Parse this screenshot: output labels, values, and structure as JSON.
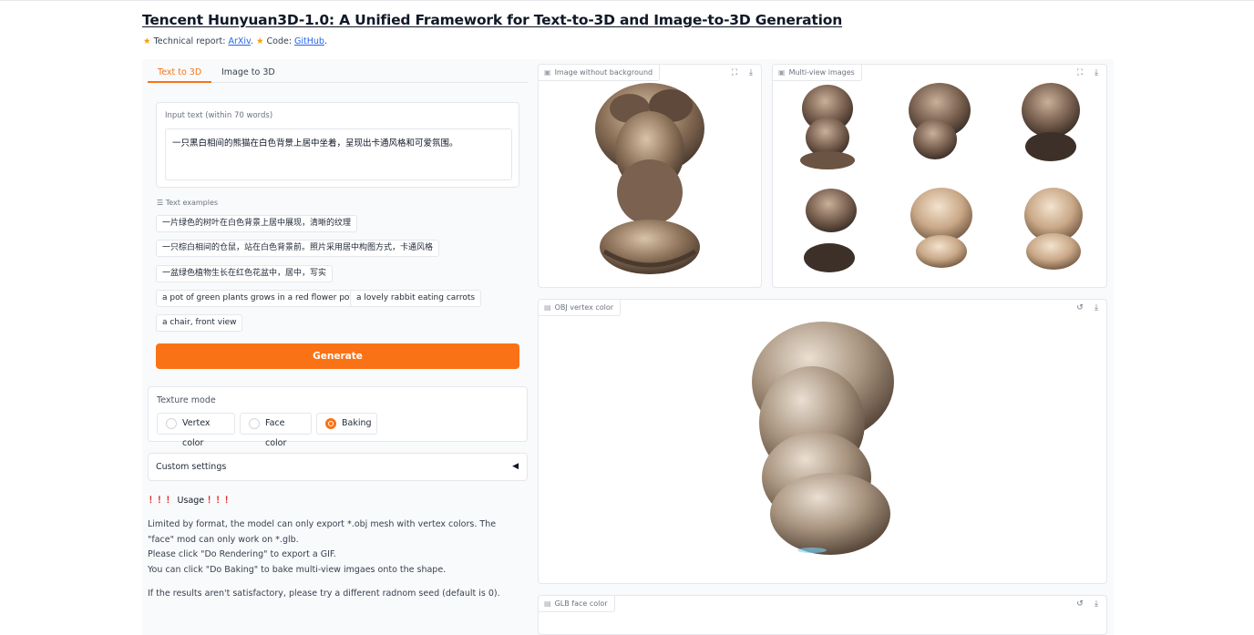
{
  "header": {
    "title": "Tencent Hunyuan3D-1.0: A Unified Framework for Text-to-3D and Image-to-3D Generation",
    "report_prefix": "Technical report: ",
    "report_link": "ArXiv",
    "code_prefix": ". ",
    "code_label": "Code: ",
    "code_link": "GitHub",
    "code_suffix": "."
  },
  "tabs": [
    {
      "label": "Text to 3D",
      "active": true
    },
    {
      "label": "Image to 3D",
      "active": false
    }
  ],
  "input": {
    "label": "Input text (within 70 words)",
    "value": "一只黑白相间的熊猫在白色背景上居中坐着，呈现出卡通风格和可爱氛围。"
  },
  "examples": {
    "label": "Text examples",
    "items": [
      "一片绿色的树叶在白色背景上居中展现，清晰的纹理",
      "一只棕白相间的仓鼠，站在白色背景前。照片采用居中构图方式，卡通风格",
      "一盆绿色植物生长在红色花盆中，居中，写实",
      "a pot of green plants grows in a red flower pot.",
      "a lovely rabbit eating carrots",
      "a chair, front view"
    ]
  },
  "generate_label": "Generate",
  "texture_mode": {
    "label": "Texture mode",
    "options": [
      "Vertex color",
      "Face color",
      "Baking"
    ],
    "selected": "Baking"
  },
  "custom_settings": {
    "label": "Custom settings",
    "arrow": "◀"
  },
  "usage": {
    "bangs_left": "！！！",
    "title": "Usage",
    "bangs_right": "！！！",
    "lines": [
      "Limited by format, the model can only export *.obj mesh with vertex colors. The \"face\" mod can only work on *.glb.",
      "Please click \"Do Rendering\" to export a GIF.",
      "You can click \"Do Baking\" to bake multi-view imgaes onto the shape."
    ],
    "seed_note": "If the results aren't satisfactory, please try a different radnom seed (default is 0)."
  },
  "panels": {
    "image_no_bg": {
      "label": "Image without background"
    },
    "multi_view": {
      "label": "Multi-view images"
    },
    "obj_vertex": {
      "label": "OBJ vertex color"
    },
    "glb_face": {
      "label": "GLB face color"
    }
  },
  "icons": {
    "image": "image-icon",
    "file": "file-icon",
    "fullscreen": "fullscreen-icon",
    "download": "download-icon",
    "reset": "reset-icon"
  },
  "colors": {
    "accent": "#f97316",
    "link": "#2563eb",
    "bang": "#dc2626"
  }
}
